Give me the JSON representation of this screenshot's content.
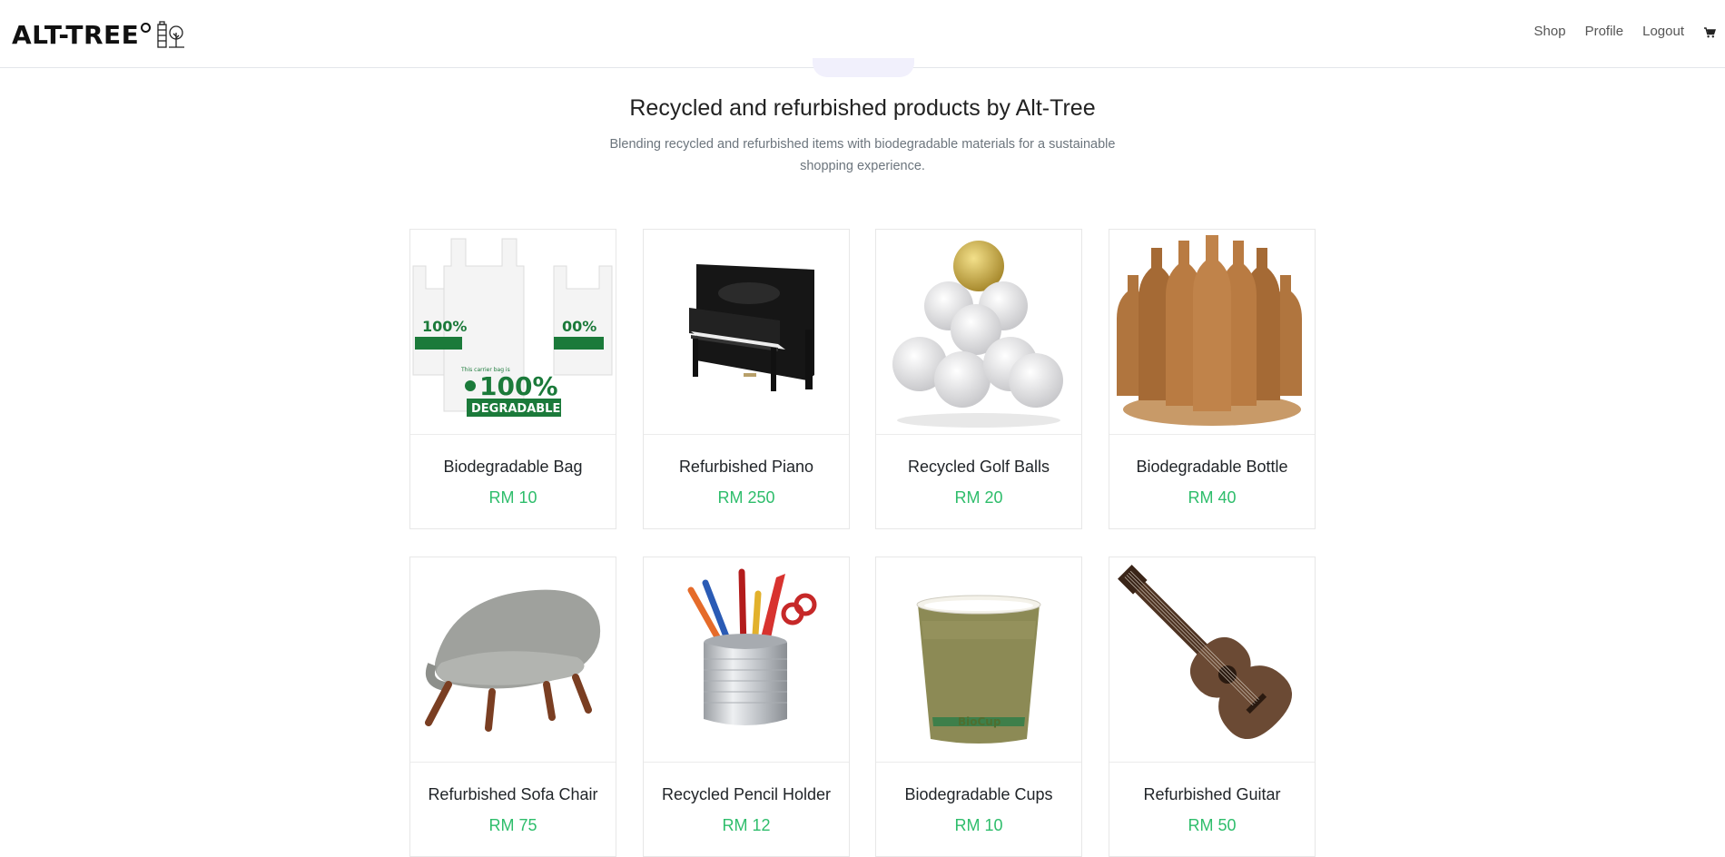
{
  "header": {
    "brand": "ALT-TREE",
    "nav": [
      {
        "label": "Shop"
      },
      {
        "label": "Profile"
      },
      {
        "label": "Logout"
      }
    ],
    "cart_icon": "cart-icon"
  },
  "hero": {
    "title": "Recycled and refurbished products by Alt-Tree",
    "subtitle": "Blending recycled and refurbished items with biodegradable materials for a sustainable shopping experience."
  },
  "products": [
    {
      "name": "Biodegradable Bag",
      "price": "RM 10",
      "image": "bag-image"
    },
    {
      "name": "Refurbished Piano",
      "price": "RM 250",
      "image": "piano-image"
    },
    {
      "name": "Recycled Golf Balls",
      "price": "RM 20",
      "image": "golf-balls-image"
    },
    {
      "name": "Biodegradable Bottle",
      "price": "RM 40",
      "image": "bottles-image"
    },
    {
      "name": "Refurbished Sofa Chair",
      "price": "RM 75",
      "image": "chair-image"
    },
    {
      "name": "Recycled Pencil Holder",
      "price": "RM 12",
      "image": "pencil-holder-image"
    },
    {
      "name": "Biodegradable Cups",
      "price": "RM 10",
      "image": "cup-image"
    },
    {
      "name": "Refurbished Guitar",
      "price": "RM 50",
      "image": "guitar-image"
    }
  ],
  "image_text": {
    "bag_line1": "This carrier bag is",
    "bag_line2": "100%",
    "bag_line3": "DEGRADABLE",
    "cup_brand": "BioCup"
  },
  "colors": {
    "price": "#2ebd6b",
    "bag_print": "#1b7a3a"
  }
}
